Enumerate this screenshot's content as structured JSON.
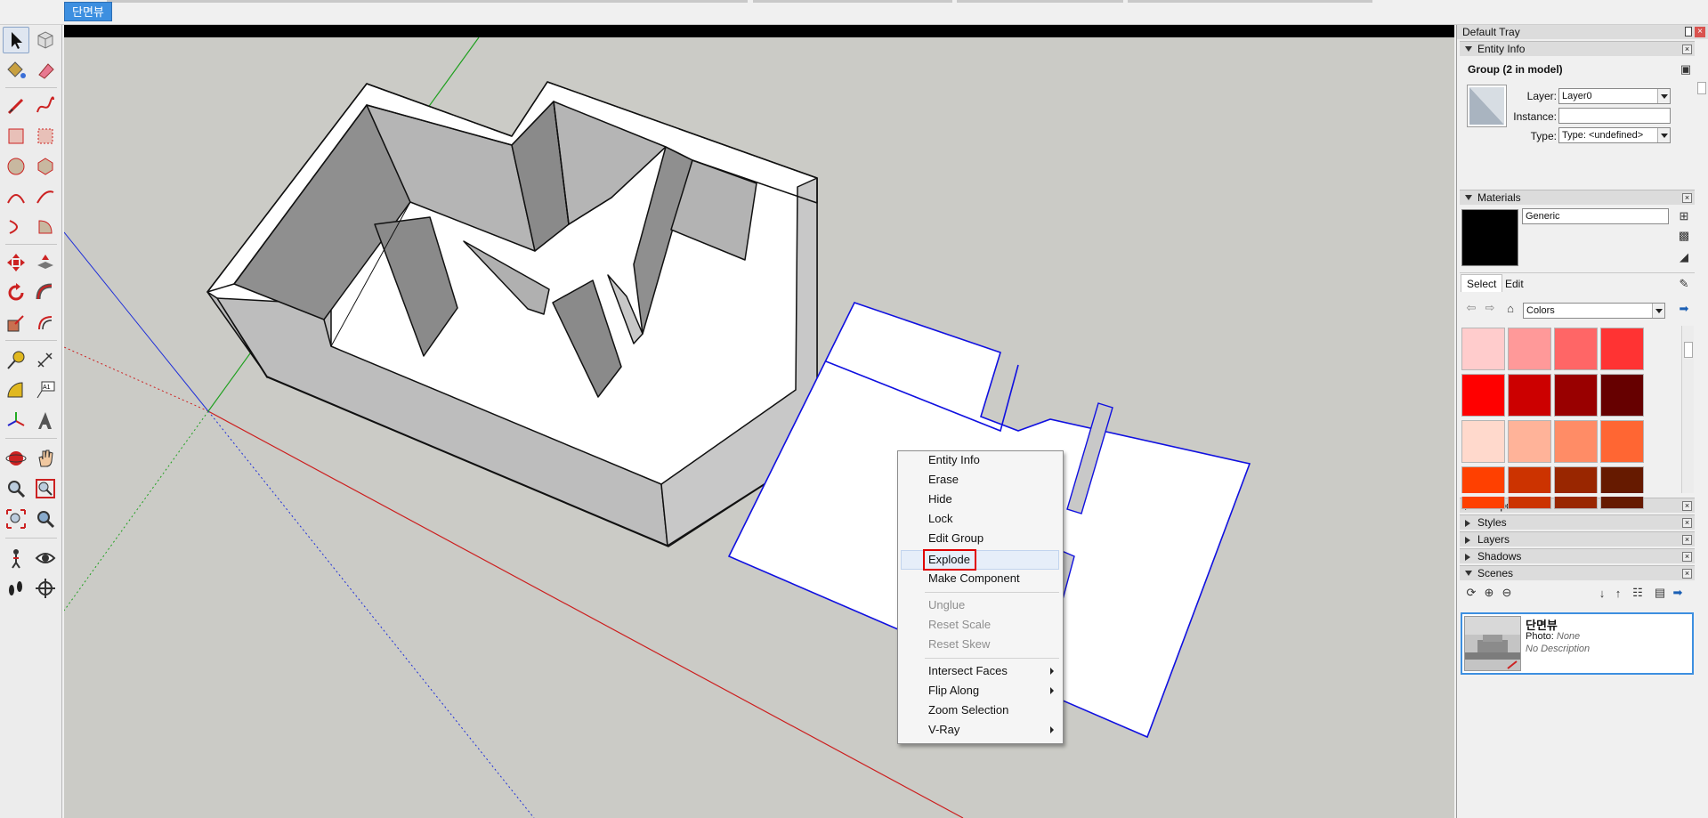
{
  "top": {
    "scene_tab": "단면뷰"
  },
  "toolbar": {
    "selected_tool": "select-tool"
  },
  "context_menu": {
    "items": [
      {
        "label": "Entity Info",
        "enabled": true,
        "submenu": false
      },
      {
        "label": "Erase",
        "enabled": true,
        "submenu": false
      },
      {
        "label": "Hide",
        "enabled": true,
        "submenu": false
      },
      {
        "label": "Lock",
        "enabled": true,
        "submenu": false
      },
      {
        "label": "Edit Group",
        "enabled": true,
        "submenu": false
      },
      {
        "label": "Explode",
        "enabled": true,
        "submenu": false,
        "highlighted": true
      },
      {
        "label": "Make Component",
        "enabled": true,
        "submenu": false
      },
      {
        "label": "Unglue",
        "enabled": false,
        "submenu": false
      },
      {
        "label": "Reset Scale",
        "enabled": false,
        "submenu": false
      },
      {
        "label": "Reset Skew",
        "enabled": false,
        "submenu": false
      },
      {
        "label": "Intersect Faces",
        "enabled": true,
        "submenu": true
      },
      {
        "label": "Flip Along",
        "enabled": true,
        "submenu": true
      },
      {
        "label": "Zoom Selection",
        "enabled": true,
        "submenu": false
      },
      {
        "label": "V-Ray",
        "enabled": true,
        "submenu": true
      }
    ]
  },
  "tray": {
    "title": "Default Tray",
    "entity_info": {
      "header": "Entity Info",
      "selection": "Group (2 in model)",
      "layer_label": "Layer:",
      "layer_value": "Layer0",
      "instance_label": "Instance:",
      "instance_value": "",
      "type_label": "Type:",
      "type_value": "Type: <undefined>"
    },
    "materials": {
      "header": "Materials",
      "name_value": "Generic",
      "tab_select": "Select",
      "tab_edit": "Edit",
      "library": "Colors",
      "swatches": [
        "#ffcccc",
        "#ff9999",
        "#ff6666",
        "#ff3333",
        "#ff0000",
        "#cc0000",
        "#990000",
        "#660000",
        "#ffd9cc",
        "#ffb399",
        "#ff8c66",
        "#ff6633",
        "#ff4000",
        "#cc3300",
        "#992600",
        "#661a00"
      ],
      "current_color": "#000000"
    },
    "collapsed": [
      "Components",
      "Styles",
      "Layers",
      "Shadows"
    ],
    "scenes": {
      "header": "Scenes",
      "scene_name": "단면뷰",
      "photo_label": "Photo:",
      "photo_value": "None",
      "description": "No Description"
    }
  }
}
